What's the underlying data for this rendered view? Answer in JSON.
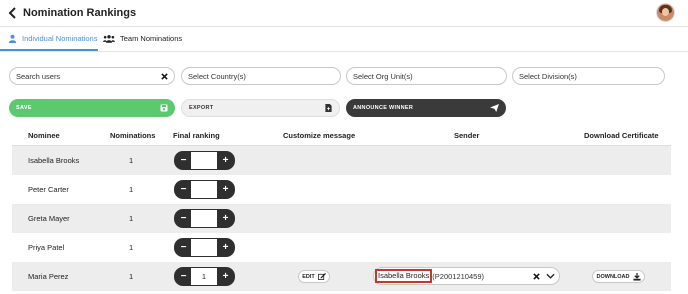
{
  "header": {
    "title": "Nomination Rankings"
  },
  "tabs": [
    {
      "label": "Individual Nominations",
      "active": true
    },
    {
      "label": "Team Nominations",
      "active": false
    }
  ],
  "filters": {
    "search_placeholder": "Search users",
    "country_placeholder": "Select Country(s)",
    "org_placeholder": "Select Org Unit(s)",
    "division_placeholder": "Select Division(s)"
  },
  "actions": {
    "save": "SAVE",
    "export": "EXPORT",
    "announce": "ANNOUNCE WINNER"
  },
  "table": {
    "columns": [
      "Nominee",
      "Nominations",
      "Final ranking",
      "Customize message",
      "Sender",
      "Download Certificate"
    ],
    "rows": [
      {
        "nominee": "Isabella Brooks",
        "nominations": "1",
        "ranking": ""
      },
      {
        "nominee": "Peter Carter",
        "nominations": "1",
        "ranking": ""
      },
      {
        "nominee": "Greta Mayer",
        "nominations": "1",
        "ranking": ""
      },
      {
        "nominee": "Priya Patel",
        "nominations": "1",
        "ranking": ""
      },
      {
        "nominee": "Maria Perez",
        "nominations": "1",
        "ranking": "1",
        "edit_label": "EDIT",
        "sender_name": "Isabella Brooks",
        "sender_id": "(P2001210459)",
        "download_label": "DOWNLOAD"
      }
    ]
  },
  "colors": {
    "accent": "#4a90e2",
    "save": "#5cc96f",
    "dark": "#3a3a3a",
    "highlight": "#c0392b"
  }
}
